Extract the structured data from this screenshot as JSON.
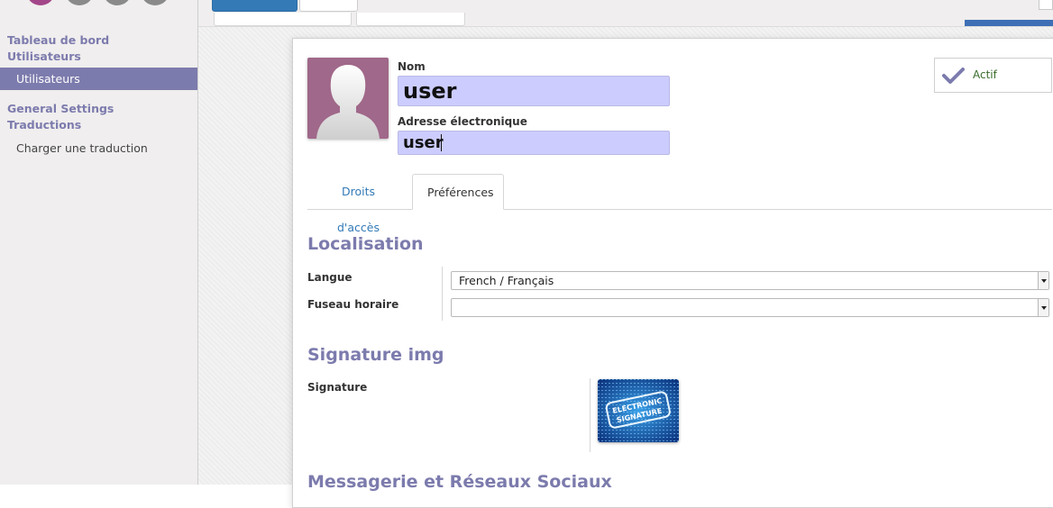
{
  "sidebar": {
    "section1_line1": "Tableau de bord",
    "section1_line2": "Utilisateurs",
    "active_item": "Utilisateurs",
    "section2_line1": "General Settings",
    "section2_line2": "Traductions",
    "item_charger": "Charger une traduction"
  },
  "form": {
    "nom_label": "Nom",
    "nom_value": "user",
    "email_label": "Adresse électronique",
    "email_value": "user",
    "actif_label": "Actif",
    "tabs": [
      {
        "label": "Droits d'accès"
      },
      {
        "label": "Préférences"
      }
    ],
    "localisation_title": "Localisation",
    "langue_label": "Langue",
    "langue_value": "French / Français",
    "fuseau_label": "Fuseau horaire",
    "fuseau_value": "",
    "signature_section_title": "Signature img",
    "signature_label": "Signature",
    "signature_image_text_1": "ELECTRONIC",
    "signature_image_text_2": "SIGNATURE",
    "messagerie_title": "Messagerie et Réseaux Sociaux"
  },
  "colors": {
    "accent": "#7c7bad",
    "primary_button": "#337ab7",
    "input_highlight": "#ccccff",
    "avatar_bg": "#a0688a",
    "check": "#7c7bad"
  }
}
